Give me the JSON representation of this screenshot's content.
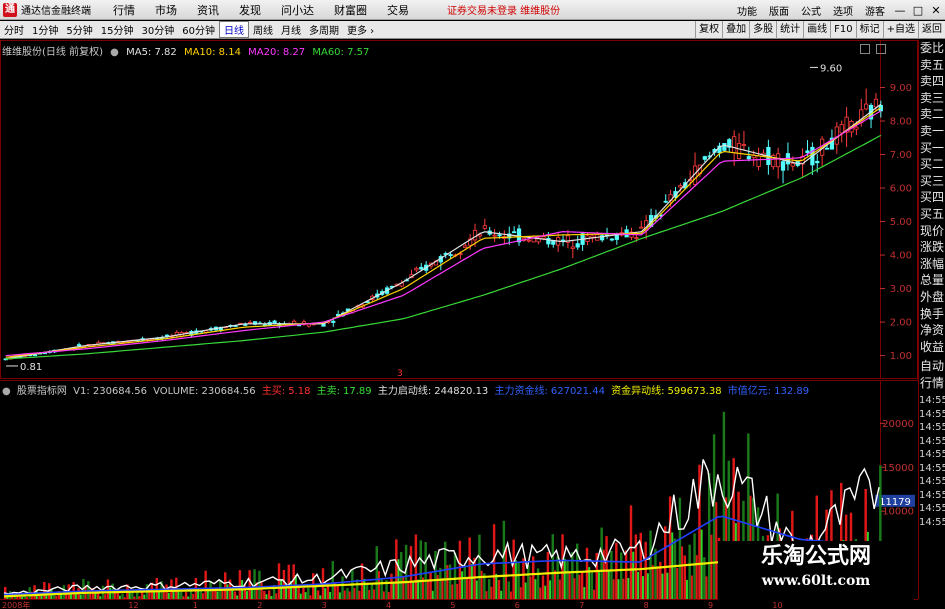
{
  "app": {
    "name": "通达信金融终端",
    "menu": [
      "行情",
      "市场",
      "资讯",
      "发现",
      "问小达",
      "财富圈",
      "交易"
    ],
    "notice": "证券交易未登录 维维股份",
    "right_menu": [
      "功能",
      "版面",
      "公式",
      "选项",
      "游客"
    ],
    "window_buttons": [
      "—",
      "□",
      "✕"
    ]
  },
  "toolbar": {
    "periods": [
      "分时",
      "1分钟",
      "5分钟",
      "15分钟",
      "30分钟",
      "60分钟",
      "日线",
      "周线",
      "月线",
      "多周期",
      "更多 ›"
    ],
    "active_period": "日线",
    "right_buttons": [
      "复权",
      "叠加",
      "多股",
      "统计",
      "画线",
      "F10",
      "标记",
      "+自选",
      "返回"
    ]
  },
  "main_chart": {
    "title": "维维股份(日线 前复权)",
    "ma": [
      {
        "label": "MA5: 7.82",
        "color": "#e0e0e0"
      },
      {
        "label": "MA10: 8.14",
        "color": "#ffd200"
      },
      {
        "label": "MA20: 8.27",
        "color": "#ff38ff"
      },
      {
        "label": "MA60: 7.57",
        "color": "#38d838"
      }
    ],
    "high_label": "9.60",
    "low_label": "0.81",
    "mid_marker": "3",
    "y_ticks": [
      "9.00",
      "8.00",
      "7.00",
      "6.00",
      "5.00",
      "4.00",
      "3.00",
      "2.00",
      "1.00"
    ]
  },
  "right_column": {
    "quote_labels": [
      "委比",
      "卖五",
      "卖四",
      "卖三",
      "卖二",
      "卖一",
      "买一",
      "买二",
      "买三",
      "买四",
      "买五",
      "现价",
      "涨跌",
      "涨幅",
      "总量",
      "外盘",
      "换手",
      "净资",
      "收益"
    ],
    "sub_labels": [
      "自动",
      "行情"
    ],
    "time_labels": [
      "14:55",
      "14:55",
      "14:55",
      "14:55",
      "14:55",
      "14:55",
      "14:55",
      "14:55",
      "14:55",
      "14:55"
    ]
  },
  "volume_panel": {
    "name": "股票指标网",
    "v1": "V1: 230684.56",
    "volume": "VOLUME: 230684.56",
    "items": [
      {
        "label": "主买:",
        "value": "5.18",
        "color": "#ff3030"
      },
      {
        "label": "主卖:",
        "value": "17.89",
        "color": "#38e038"
      },
      {
        "label": "主力启动线:",
        "value": "244820.13",
        "color": "#e0e0e0"
      },
      {
        "label": "主力资金线:",
        "value": "627021.44",
        "color": "#3060ff"
      },
      {
        "label": "资金异动线:",
        "value": "599673.38",
        "color": "#f0f000"
      },
      {
        "label": "市值亿元:",
        "value": "132.89",
        "color": "#3060ff"
      }
    ],
    "y_ticks": [
      "20000",
      "15000",
      "10000"
    ],
    "current_value": "11179"
  },
  "date_axis": [
    "2008年",
    "12",
    "1",
    "2",
    "3",
    "4",
    "5",
    "6",
    "7",
    "8",
    "9",
    "10"
  ],
  "watermark": {
    "title": "乐淘公式网",
    "url": "www.60lt.com"
  },
  "colors": {
    "up": "#ff3c3c",
    "down": "#54ffff",
    "grid": "#7a0000",
    "axis_text": "#c03030"
  },
  "chart_data": [
    {
      "type": "line",
      "title": "维维股份(日线 前复权)",
      "xlabel": "",
      "ylabel": "",
      "x": [
        "2008-11",
        "2008-12",
        "2009-01",
        "2009-02",
        "2009-03",
        "2009-04",
        "2009-05",
        "2009-06",
        "2009-07",
        "2009-08",
        "2009-09",
        "2009-10"
      ],
      "ylim": [
        0.6,
        10.0
      ],
      "series": [
        {
          "name": "MA5",
          "values": [
            0.9,
            1.3,
            1.55,
            1.95,
            1.95,
            3.2,
            4.7,
            4.4,
            4.7,
            7.3,
            6.7,
            8.5
          ]
        },
        {
          "name": "MA10",
          "values": [
            0.95,
            1.25,
            1.5,
            1.85,
            1.98,
            3.0,
            4.5,
            4.6,
            4.65,
            7.1,
            6.8,
            8.4
          ]
        },
        {
          "name": "MA20",
          "values": [
            1.0,
            1.2,
            1.45,
            1.75,
            2.0,
            2.8,
            4.2,
            4.7,
            4.6,
            6.8,
            6.9,
            8.3
          ]
        },
        {
          "name": "MA60",
          "values": [
            0.9,
            1.05,
            1.25,
            1.45,
            1.7,
            2.1,
            2.8,
            3.6,
            4.5,
            5.3,
            6.3,
            7.57
          ]
        }
      ],
      "annotations": [
        {
          "label": "9.60",
          "value": 9.6
        },
        {
          "label": "0.81",
          "value": 0.81
        }
      ]
    },
    {
      "type": "bar",
      "title": "股票指标网",
      "x": [
        "2008-11",
        "2008-12",
        "2009-01",
        "2009-02",
        "2009-03",
        "2009-04",
        "2009-05",
        "2009-06",
        "2009-07",
        "2009-08",
        "2009-09",
        "2009-10"
      ],
      "ylim": [
        0,
        23000
      ],
      "series": [
        {
          "name": "VOLUME",
          "values": [
            900,
            1500,
            1700,
            2400,
            2600,
            4300,
            5900,
            5200,
            6700,
            14000,
            6600,
            11179
          ]
        },
        {
          "name": "主力启动线",
          "values": [
            600,
            1300,
            1500,
            1900,
            2300,
            3800,
            5200,
            4700,
            5500,
            14800,
            5500,
            13000
          ]
        },
        {
          "name": "主力资金线",
          "values": [
            500,
            900,
            1100,
            1300,
            1700,
            2500,
            4000,
            4400,
            4200,
            9500,
            6800,
            6000
          ]
        },
        {
          "name": "资金异动线",
          "values": [
            300,
            700,
            900,
            1100,
            1500,
            1900,
            2500,
            3000,
            3400,
            4200,
            4800,
            5600
          ]
        }
      ]
    }
  ]
}
